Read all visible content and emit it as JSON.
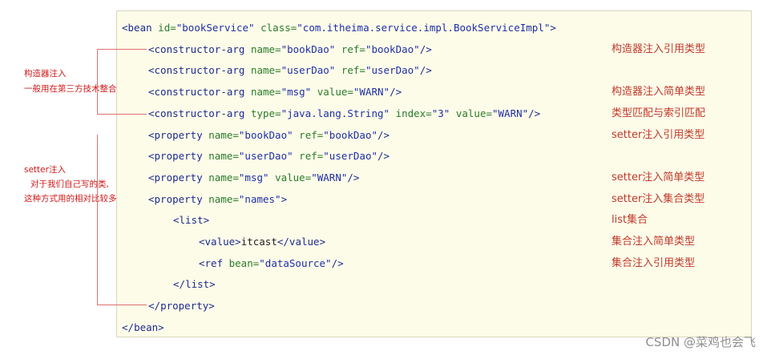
{
  "code": {
    "l1": {
      "open": "<",
      "tag": "bean",
      "a1": " id=",
      "v1": "\"bookService\"",
      "a2": " class=",
      "v2": "\"com.itheima.service.impl.BookServiceImpl\"",
      "close": ">"
    },
    "l2": {
      "open": "<",
      "tag": "constructor-arg",
      "a1": " name=",
      "v1": "\"bookDao\"",
      "a2": " ref=",
      "v2": "\"bookDao\"",
      "close": "/>"
    },
    "l3": {
      "open": "<",
      "tag": "constructor-arg",
      "a1": " name=",
      "v1": "\"userDao\"",
      "a2": " ref=",
      "v2": "\"userDao\"",
      "close": "/>"
    },
    "l4": {
      "open": "<",
      "tag": "constructor-arg",
      "a1": " name=",
      "v1": "\"msg\"",
      "a2": " value=",
      "v2": "\"WARN\"",
      "close": "/>"
    },
    "l5": {
      "open": "<",
      "tag": "constructor-arg",
      "a1": " type=",
      "v1": "\"java.lang.String\"",
      "a2": " index=",
      "v2": "\"3\"",
      "a3": " value=",
      "v3": "\"WARN\"",
      "close": "/>"
    },
    "l6": {
      "open": "<",
      "tag": "property",
      "a1": " name=",
      "v1": "\"bookDao\"",
      "a2": " ref=",
      "v2": "\"bookDao\"",
      "close": "/>"
    },
    "l7": {
      "open": "<",
      "tag": "property",
      "a1": " name=",
      "v1": "\"userDao\"",
      "a2": " ref=",
      "v2": "\"userDao\"",
      "close": "/>"
    },
    "l8": {
      "open": "<",
      "tag": "property",
      "a1": " name=",
      "v1": "\"msg\"",
      "a2": " value=",
      "v2": "\"WARN\"",
      "close": "/>"
    },
    "l9": {
      "open": "<",
      "tag": "property",
      "a1": " name=",
      "v1": "\"names\"",
      "close": ">"
    },
    "l10": {
      "open": "<",
      "tag": "list",
      "close": ">"
    },
    "l11": {
      "open": "<",
      "tag": "value",
      "close": ">",
      "text": "itcast",
      "open2": "</",
      "tag2": "value",
      "close2": ">"
    },
    "l12": {
      "open": "<",
      "tag": "ref",
      "a1": " bean=",
      "v1": "\"dataSource\"",
      "close": "/>"
    },
    "l13": {
      "open": "</",
      "tag": "list",
      "close": ">"
    },
    "l14": {
      "open": "</",
      "tag": "property",
      "close": ">"
    },
    "l15": {
      "open": "</",
      "tag": "bean",
      "close": ">"
    }
  },
  "notes": {
    "n2": "构造器注入引用类型",
    "n4": "构造器注入简单类型",
    "n5": "类型匹配与索引匹配",
    "n6": "setter注入引用类型",
    "n8": "setter注入简单类型",
    "n9": "setter注入集合类型",
    "n10": "list集合",
    "n11": "集合注入简单类型",
    "n12": "集合注入引用类型"
  },
  "side": {
    "ctor_title": "构造器注入",
    "ctor_desc": "一般用在第三方技术整合",
    "setter_title": "setter注入",
    "setter_desc1": "对于我们自己写的类,",
    "setter_desc2": "这种方式用的相对比较多"
  },
  "watermark": "CSDN @菜鸡也会飞"
}
